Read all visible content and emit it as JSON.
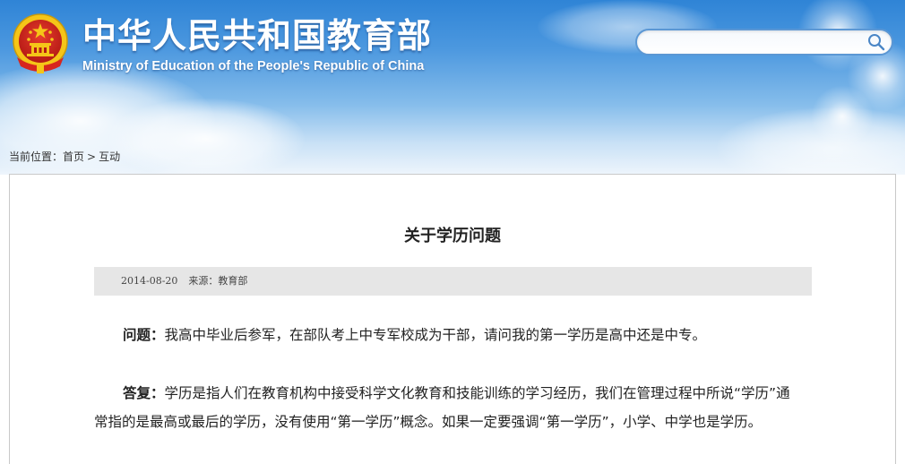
{
  "header": {
    "site_title": "中华人民共和国教育部",
    "site_subtitle": "Ministry of Education of the People's Republic of China",
    "search": {
      "placeholder": "",
      "value": ""
    }
  },
  "breadcrumb": {
    "prefix": "当前位置：",
    "home": "首页",
    "separator": ">",
    "current": "互动"
  },
  "article": {
    "title": "关于学历问题",
    "meta": {
      "date": "2014-08-20",
      "source": "来源：教育部"
    },
    "question": {
      "label": "问题：",
      "text": "我高中毕业后参军，在部队考上中专军校成为干部，请问我的第一学历是高中还是中专。"
    },
    "answer": {
      "label": "答复：",
      "text": "学历是指人们在教育机构中接受科学文化教育和技能训练的学习经历，我们在管理过程中所说“学历”通常指的是最高或最后的学历，没有使用“第一学历”概念。如果一定要强调“第一学历”，小学、中学也是学历。"
    }
  },
  "colors": {
    "header_top": "#2f84d6",
    "header_bottom": "#eef5fc",
    "meta_bar": "#e6e6e6",
    "panel_border": "#c9c9c9",
    "emblem_red": "#d7261e",
    "emblem_gold": "#f5c518"
  },
  "icons": {
    "emblem": "national-emblem-icon",
    "search": "search-icon"
  }
}
